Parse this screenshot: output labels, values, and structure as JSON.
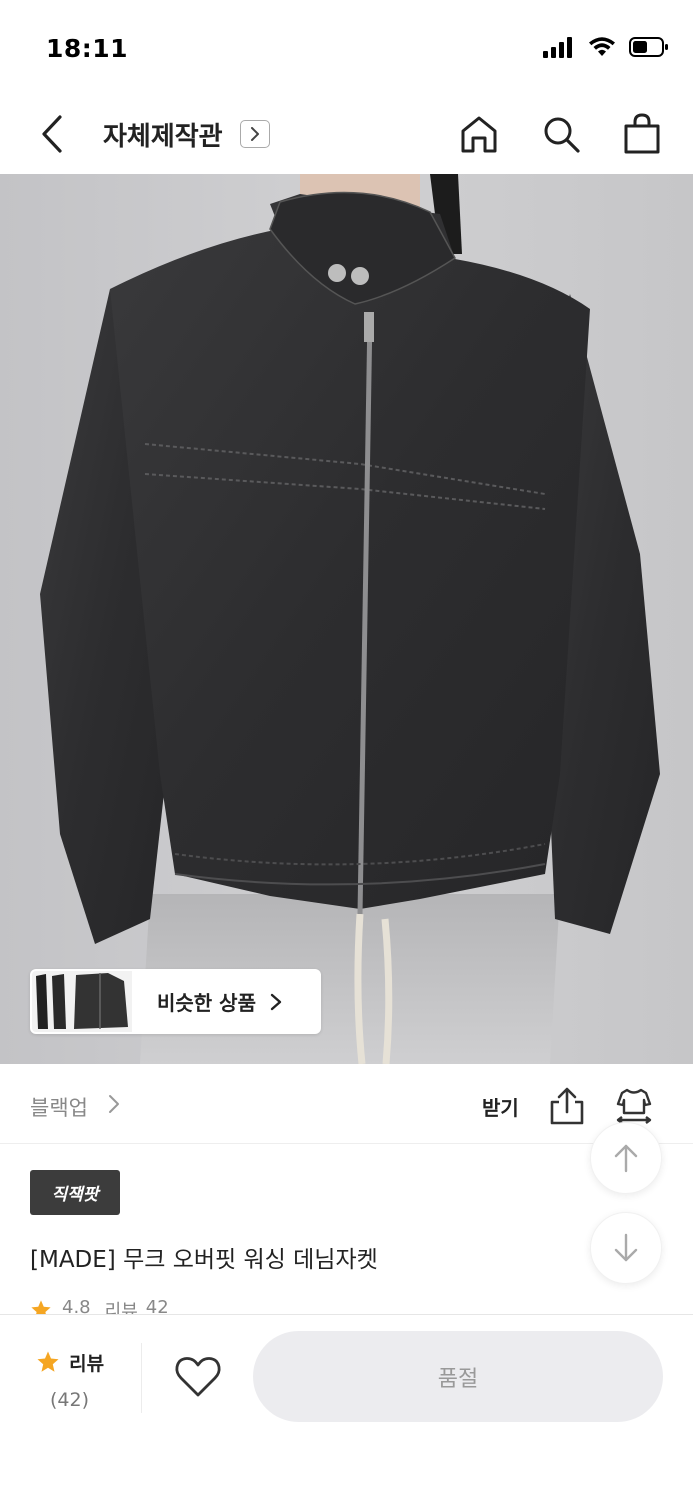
{
  "status": {
    "time": "18:11"
  },
  "header": {
    "store_title": "자체제작관"
  },
  "similar": {
    "label": "비슷한 상품"
  },
  "brand": {
    "name": "블랙업",
    "coupon_label": "받기"
  },
  "product": {
    "badge": "직잭팟",
    "name": "[MADE] 무크 오버핏 워싱 데님자켓",
    "rating": "4.8",
    "rating_fraction": 0.96,
    "review_label": "리뷰",
    "review_count": "42"
  },
  "bottom": {
    "review_label": "리뷰",
    "review_count": "(42)",
    "soldout_label": "품절"
  },
  "colors": {
    "accent_star": "#f5a623",
    "soldout_bg": "#ececef",
    "badge_bg": "#3c3c3c"
  },
  "icons": [
    "back-icon",
    "chevron-right-icon",
    "home-icon",
    "search-icon",
    "shopping-bag-icon",
    "share-icon",
    "fit-icon",
    "arrow-up-icon",
    "arrow-down-icon",
    "star-icon",
    "heart-icon"
  ]
}
